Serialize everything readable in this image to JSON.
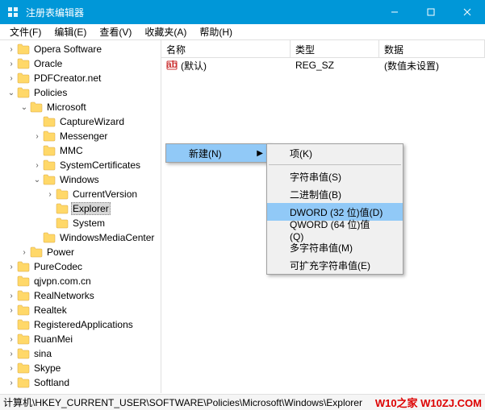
{
  "window": {
    "title": "注册表编辑器"
  },
  "menubar": {
    "file": "文件(F)",
    "edit": "编辑(E)",
    "view": "查看(V)",
    "favorites": "收藏夹(A)",
    "help": "帮助(H)"
  },
  "tree": [
    {
      "depth": 0,
      "exp": ">",
      "label": "Opera Software"
    },
    {
      "depth": 0,
      "exp": ">",
      "label": "Oracle"
    },
    {
      "depth": 0,
      "exp": ">",
      "label": "PDFCreator.net"
    },
    {
      "depth": 0,
      "exp": "v",
      "label": "Policies"
    },
    {
      "depth": 1,
      "exp": "v",
      "label": "Microsoft"
    },
    {
      "depth": 2,
      "exp": "",
      "label": "CaptureWizard"
    },
    {
      "depth": 2,
      "exp": ">",
      "label": "Messenger"
    },
    {
      "depth": 2,
      "exp": "",
      "label": "MMC"
    },
    {
      "depth": 2,
      "exp": ">",
      "label": "SystemCertificates"
    },
    {
      "depth": 2,
      "exp": "v",
      "label": "Windows"
    },
    {
      "depth": 3,
      "exp": ">",
      "label": "CurrentVersion"
    },
    {
      "depth": 3,
      "exp": "",
      "label": "Explorer",
      "selected": true
    },
    {
      "depth": 3,
      "exp": "",
      "label": "System"
    },
    {
      "depth": 2,
      "exp": "",
      "label": "WindowsMediaCenter"
    },
    {
      "depth": 1,
      "exp": ">",
      "label": "Power"
    },
    {
      "depth": 0,
      "exp": ">",
      "label": "PureCodec"
    },
    {
      "depth": 0,
      "exp": "",
      "label": "qjvpn.com.cn"
    },
    {
      "depth": 0,
      "exp": ">",
      "label": "RealNetworks"
    },
    {
      "depth": 0,
      "exp": ">",
      "label": "Realtek"
    },
    {
      "depth": 0,
      "exp": "",
      "label": "RegisteredApplications"
    },
    {
      "depth": 0,
      "exp": ">",
      "label": "RuanMei"
    },
    {
      "depth": 0,
      "exp": ">",
      "label": "sina"
    },
    {
      "depth": 0,
      "exp": ">",
      "label": "Skype"
    },
    {
      "depth": 0,
      "exp": ">",
      "label": "Softland"
    }
  ],
  "list": {
    "columns": {
      "name": "名称",
      "type": "类型",
      "data": "数据"
    },
    "rows": [
      {
        "name": "(默认)",
        "type": "REG_SZ",
        "data": "(数值未设置)"
      }
    ]
  },
  "context_main": {
    "new_label": "新建(N)"
  },
  "context_sub": {
    "key": "项(K)",
    "string": "字符串值(S)",
    "binary": "二进制值(B)",
    "dword": "DWORD (32 位)值(D)",
    "qword": "QWORD (64 位)值(Q)",
    "multi": "多字符串值(M)",
    "expand": "可扩充字符串值(E)"
  },
  "statusbar": {
    "path": "计算机\\HKEY_CURRENT_USER\\SOFTWARE\\Policies\\Microsoft\\Windows\\Explorer",
    "watermark": "W10之家 W10ZJ.COM"
  }
}
